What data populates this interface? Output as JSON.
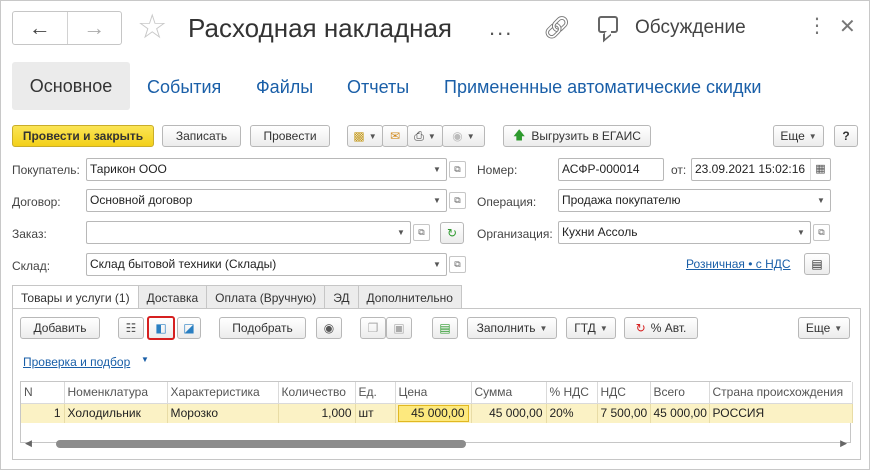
{
  "window": {
    "title": "Расходная накладная",
    "title_dots": "...",
    "discussion_label": "Обсуждение"
  },
  "section_tabs": [
    "Основное",
    "События",
    "Файлы",
    "Отчеты",
    "Примененные автоматические скидки"
  ],
  "toolbar": {
    "post_close": "Провести и закрыть",
    "save": "Записать",
    "post": "Провести",
    "egais": "Выгрузить в ЕГАИС",
    "more": "Еще",
    "help": "?"
  },
  "form": {
    "buyer_label": "Покупатель:",
    "buyer_value": "Тарикон ООО",
    "contract_label": "Договор:",
    "contract_value": "Основной договор",
    "order_label": "Заказ:",
    "order_value": "",
    "warehouse_label": "Склад:",
    "warehouse_value": "Склад бытовой техники (Склады)",
    "number_label": "Номер:",
    "number_value": "АСФР-000014",
    "from_label": "от:",
    "date_value": "23.09.2021 15:02:16",
    "operation_label": "Операция:",
    "operation_value": "Продажа покупателю",
    "org_label": "Организация:",
    "org_value": "Кухни Ассоль",
    "price_type_link": "Розничная • с НДС"
  },
  "tabs": [
    "Товары и услуги (1)",
    "Доставка",
    "Оплата (Вручную)",
    "ЭД",
    "Дополнительно"
  ],
  "goods_toolbar": {
    "add": "Добавить",
    "pick": "Подобрать",
    "fill": "Заполнить",
    "gtd": "ГТД",
    "auto_pct": "% Авт.",
    "more": "Еще"
  },
  "check_link": "Проверка и подбор",
  "grid": {
    "columns": [
      "N",
      "Номенклатура",
      "Характеристика",
      "Количество",
      "Ед.",
      "Цена",
      "Сумма",
      "% НДС",
      "НДС",
      "Всего",
      "Страна происхождения"
    ],
    "rows": [
      {
        "n": "1",
        "item": "Холодильник",
        "characteristic": "Морозко",
        "qty": "1,000",
        "unit": "шт",
        "price": "45 000,00",
        "sum": "45 000,00",
        "vat_pct": "20%",
        "vat": "7 500,00",
        "total": "45 000,00",
        "country": "РОССИЯ"
      }
    ]
  },
  "colors": {
    "primary_button": "#f3d019",
    "link": "#1a5fa8",
    "row_highlight": "#fbf2c5",
    "selected_cell": "#fde97e",
    "highlight_border": "#d62020"
  }
}
